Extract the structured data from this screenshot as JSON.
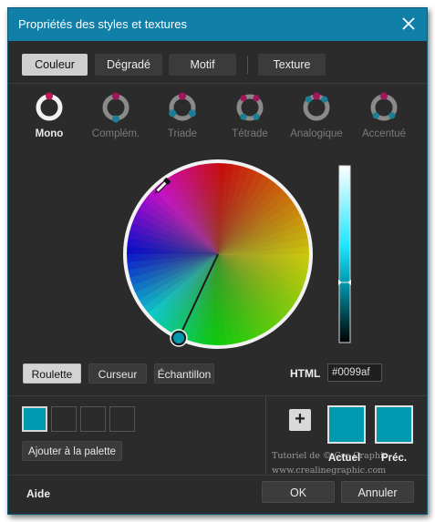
{
  "window": {
    "title": "Propriétés des styles et textures"
  },
  "tabs": [
    {
      "label": "Couleur",
      "active": true
    },
    {
      "label": "Dégradé",
      "active": false
    },
    {
      "label": "Motif",
      "active": false
    },
    {
      "label": "Texture",
      "active": false
    }
  ],
  "harmonies": [
    {
      "label": "Mono",
      "icon": "mono-harmony-icon",
      "active": true
    },
    {
      "label": "Complém.",
      "icon": "complementary-harmony-icon",
      "active": false
    },
    {
      "label": "Triade",
      "icon": "triad-harmony-icon",
      "active": false
    },
    {
      "label": "Tétrade",
      "icon": "tetrad-harmony-icon",
      "active": false
    },
    {
      "label": "Analogique",
      "icon": "analogous-harmony-icon",
      "active": false
    },
    {
      "label": "Accentué",
      "icon": "accented-harmony-icon",
      "active": false
    }
  ],
  "mode_buttons": [
    {
      "label": "Roulette",
      "active": true
    },
    {
      "label": "Curseur",
      "active": false
    },
    {
      "label": "Échantillon",
      "active": false
    }
  ],
  "html_field": {
    "label": "HTML",
    "value": "#0099af"
  },
  "palette": {
    "add_label": "Ajouter à  la palette",
    "swatches": [
      "#0099af",
      "",
      "",
      ""
    ]
  },
  "current": {
    "label": "Actuel",
    "color": "#0099af"
  },
  "previous": {
    "label": "Préc.",
    "color": "#0099af"
  },
  "watermark": {
    "line1": "Tutoriel de © Cre Graphic",
    "line2": "www.crealinegraphic.com"
  },
  "footer": {
    "help": "Aide",
    "ok": "OK",
    "cancel": "Annuler"
  },
  "colors": {
    "accent": "#1180a8",
    "selected": "#0099af",
    "magenta": "#c2185b"
  }
}
